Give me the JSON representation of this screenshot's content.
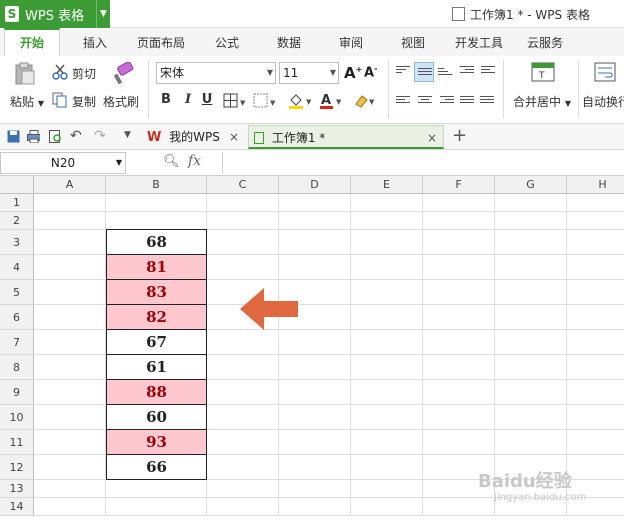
{
  "app": {
    "name": "WPS 表格",
    "logo": "S",
    "window_title": "工作簿1 * - WPS 表格"
  },
  "ribbon_tabs": [
    {
      "label": "开始",
      "active": true
    },
    {
      "label": "插入"
    },
    {
      "label": "页面布局"
    },
    {
      "label": "公式"
    },
    {
      "label": "数据"
    },
    {
      "label": "审阅"
    },
    {
      "label": "视图"
    },
    {
      "label": "开发工具"
    },
    {
      "label": "云服务"
    }
  ],
  "ribbon": {
    "paste": "粘贴",
    "cut": "剪切",
    "copy": "复制",
    "format_painter": "格式刷",
    "font_name": "宋体",
    "font_size": "11",
    "bold": "B",
    "italic": "I",
    "underline": "U",
    "merge_center": "合并居中",
    "wrap_text": "自动换行"
  },
  "doc_tabs": [
    {
      "label": "我的WPS"
    },
    {
      "label": "工作簿1 *",
      "active": true
    }
  ],
  "namebox": "N20",
  "fx": "fx",
  "columns": [
    "A",
    "B",
    "C",
    "D",
    "E",
    "F",
    "G",
    "H"
  ],
  "rows": [
    "1",
    "2",
    "3",
    "4",
    "5",
    "6",
    "7",
    "8",
    "9",
    "10",
    "11",
    "12",
    "13",
    "14"
  ],
  "cells": [
    {
      "row": "3",
      "value": "68",
      "highlight": false
    },
    {
      "row": "4",
      "value": "81",
      "highlight": true
    },
    {
      "row": "5",
      "value": "83",
      "highlight": true
    },
    {
      "row": "6",
      "value": "82",
      "highlight": true
    },
    {
      "row": "7",
      "value": "67",
      "highlight": false
    },
    {
      "row": "8",
      "value": "61",
      "highlight": false
    },
    {
      "row": "9",
      "value": "88",
      "highlight": true
    },
    {
      "row": "10",
      "value": "60",
      "highlight": false
    },
    {
      "row": "11",
      "value": "93",
      "highlight": true
    },
    {
      "row": "12",
      "value": "66",
      "highlight": false
    }
  ],
  "colors": {
    "brand": "#3d9b35",
    "highlight_fill": "#ffc7ce",
    "highlight_text": "#9c0006",
    "arrow": "#e0683e"
  },
  "watermark": {
    "text": "Baidu经验",
    "sub": "jingyan.baidu.com"
  }
}
